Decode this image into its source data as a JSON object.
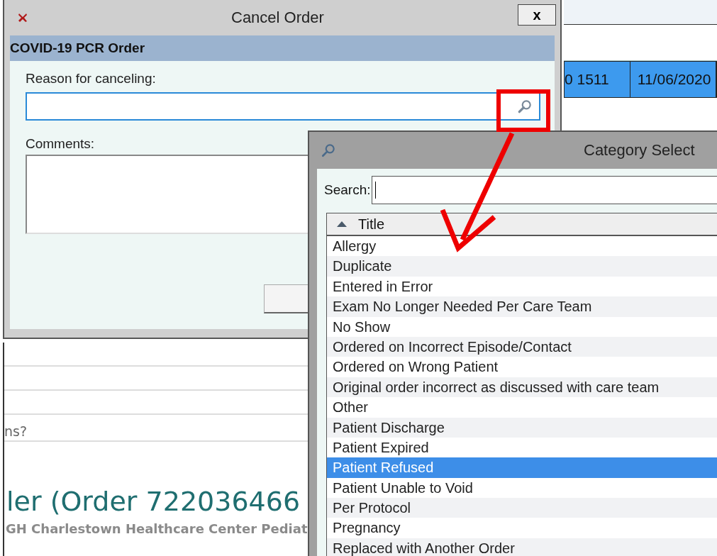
{
  "background": {
    "table_row": {
      "cells": [
        "0 1511",
        "11/06/2020"
      ],
      "selected": true
    },
    "question_fragment": "ns?",
    "heading": "ler (Order 722036466",
    "subtitle": "GH Charlestown Healthcare Center Pediat"
  },
  "cancel_dialog": {
    "title": "Cancel Order",
    "close_label": "x",
    "order_name": "COVID-19 PCR Order",
    "reason_label": "Reason for canceling:",
    "comments_label": "Comments:"
  },
  "category_dialog": {
    "title": "Category Select",
    "search_label": "Search:",
    "column": "Title",
    "sort_ascending": true,
    "items": [
      {
        "label": "Allergy",
        "selected": false
      },
      {
        "label": "Duplicate",
        "selected": false
      },
      {
        "label": "Entered in Error",
        "selected": false
      },
      {
        "label": "Exam No Longer Needed Per Care Team",
        "selected": false
      },
      {
        "label": "No Show",
        "selected": false
      },
      {
        "label": "Ordered on Incorrect Episode/Contact",
        "selected": false
      },
      {
        "label": "Ordered on Wrong Patient",
        "selected": false
      },
      {
        "label": "Original order incorrect as discussed with care team",
        "selected": false
      },
      {
        "label": "Other",
        "selected": false
      },
      {
        "label": "Patient Discharge",
        "selected": false
      },
      {
        "label": "Patient Expired",
        "selected": false
      },
      {
        "label": "Patient Refused",
        "selected": true
      },
      {
        "label": "Patient Unable to Void",
        "selected": false
      },
      {
        "label": "Per Protocol",
        "selected": false
      },
      {
        "label": "Pregnancy",
        "selected": false
      },
      {
        "label": "Replaced with Another Order",
        "selected": false
      }
    ]
  }
}
